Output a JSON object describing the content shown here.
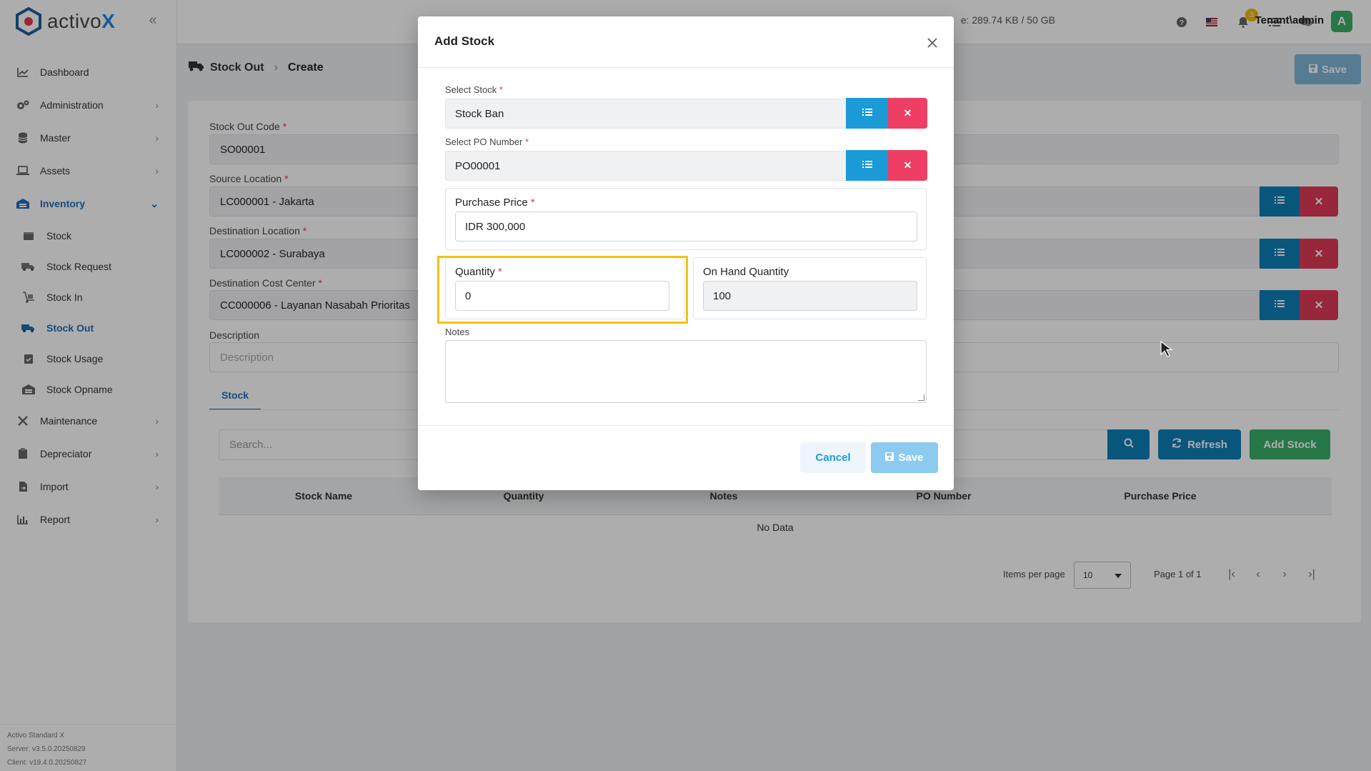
{
  "app": {
    "logo_text_main": "activo",
    "logo_text_accent": "X"
  },
  "topbar": {
    "storage_text": "e: 289.74 KB / 50 GB",
    "notification_count": "3",
    "user_label": "Tenant\\admin",
    "avatar_letter": "A"
  },
  "sidebar": {
    "items": [
      {
        "label": "Dashboard"
      },
      {
        "label": "Administration"
      },
      {
        "label": "Master"
      },
      {
        "label": "Assets"
      },
      {
        "label": "Inventory"
      },
      {
        "label": "Maintenance"
      },
      {
        "label": "Depreciator"
      },
      {
        "label": "Import"
      },
      {
        "label": "Report"
      }
    ],
    "inventory_sub": [
      {
        "label": "Stock"
      },
      {
        "label": "Stock Request"
      },
      {
        "label": "Stock In"
      },
      {
        "label": "Stock Out"
      },
      {
        "label": "Stock Usage"
      },
      {
        "label": "Stock Opname"
      }
    ],
    "version": {
      "line1": "Activo Standard X",
      "line2": "Server: v3.5.0.20250829",
      "line3": "Client: v19.4.0.20250827"
    }
  },
  "page": {
    "breadcrumb_1": "Stock Out",
    "breadcrumb_2": "Create",
    "save_label": "Save",
    "fields": {
      "code_label": "Stock Out Code",
      "code_value": "SO00001",
      "source_label": "Source Location",
      "source_value": "LC000001 - Jakarta",
      "dest_label": "Destination Location",
      "dest_value": "LC000002 - Surabaya",
      "cost_label": "Destination Cost Center",
      "cost_value": "CC000006 - Layanan Nasabah Prioritas",
      "desc_label": "Description",
      "desc_placeholder": "Description"
    },
    "tab_stock": "Stock",
    "search_placeholder": "Search...",
    "refresh_label": "Refresh",
    "add_stock_label": "Add Stock",
    "table": {
      "columns": [
        "Stock Name",
        "Quantity",
        "Notes",
        "PO Number",
        "Purchase Price"
      ],
      "empty_text": "No Data"
    },
    "pager": {
      "items_per_page_label": "Items per page",
      "items_per_page_value": "10",
      "page_text": "Page 1 of 1"
    }
  },
  "modal": {
    "title": "Add Stock",
    "select_stock_label": "Select Stock",
    "select_stock_value": "Stock Ban",
    "select_po_label": "Select PO Number",
    "select_po_value": "PO00001",
    "purchase_price_label": "Purchase Price",
    "purchase_price_value": "IDR 300,000",
    "quantity_label": "Quantity",
    "quantity_value": "0",
    "on_hand_label": "On Hand Quantity",
    "on_hand_value": "100",
    "notes_label": "Notes",
    "notes_value": "",
    "cancel_label": "Cancel",
    "save_label": "Save"
  },
  "colors": {
    "primary": "#0e7fb8",
    "danger": "#e03a57",
    "success": "#3ab06a",
    "highlight": "#f4c20d"
  }
}
